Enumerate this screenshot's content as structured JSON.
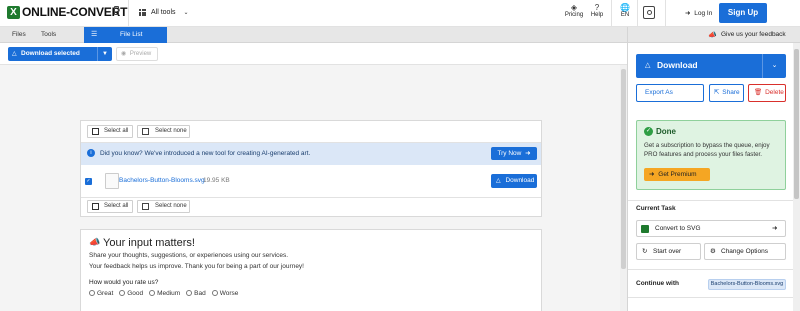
{
  "header": {
    "logo_mark": "X",
    "logo_text": "ONLINE-CONVERT",
    "all_tools_label": "All tools",
    "pricing_label": "Pricing",
    "help_label": "Help",
    "language_label": "EN",
    "login_label": "Log In",
    "signup_label": "Sign Up"
  },
  "tabs": {
    "files": "Files",
    "tools": "Tools",
    "file_list": "File List",
    "feedback": "Give us your feedback"
  },
  "toolbar": {
    "download_selected": "Download selected",
    "preview": "Preview"
  },
  "file_list": {
    "select_all": "Select all",
    "select_none": "Select none",
    "info_text": "Did you know? We've introduced a new tool for creating AI-generated art.",
    "try_now": "Try Now",
    "file_name": "Bachelors-Button-Blooms.svg",
    "file_size": "19.95 KB",
    "download": "Download"
  },
  "feedback_card": {
    "title": "Your input matters!",
    "line1": "Share your thoughts, suggestions, or experiences using our services.",
    "line2": "Your feedback helps us improve. Thank you for being a part of our journey!",
    "question": "How would you rate us?",
    "options": [
      "Great",
      "Good",
      "Medium",
      "Bad",
      "Worse"
    ]
  },
  "sidebar": {
    "download": "Download",
    "export_as": "Export As",
    "share": "Share",
    "delete": "Delete",
    "done_title": "Done",
    "done_text": "Get a subscription to bypass the queue, enjoy PRO features and process your files faster.",
    "get_premium": "Get Premium",
    "current_task": "Current Task",
    "convert_to": "Convert to SVG",
    "start_over": "Start over",
    "change_options": "Change Options",
    "continue_with": "Continue with",
    "continue_chip": "Bachelors-Button-Blooms.svg"
  },
  "colors": {
    "accent": "#1a6ed8",
    "done_bg": "#dff3e2",
    "premium": "#f5a623",
    "delete": "#d9302c"
  }
}
